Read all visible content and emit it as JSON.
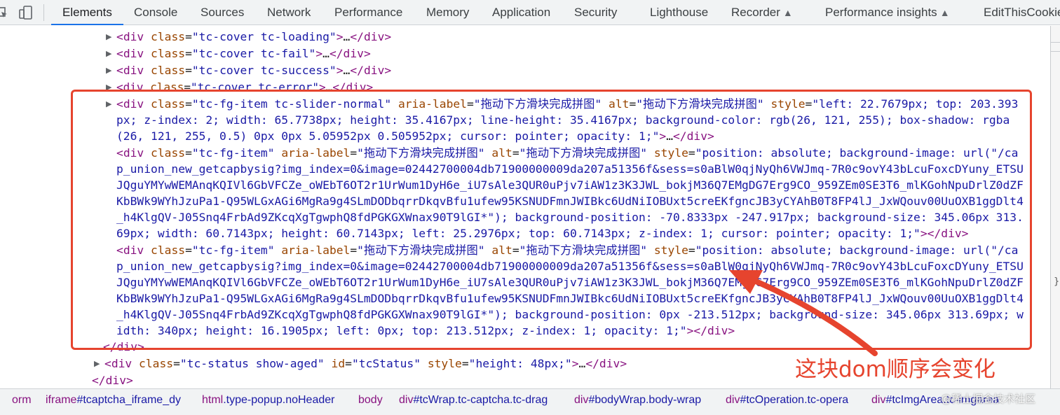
{
  "toolbar": {
    "tabs": [
      {
        "label": "Elements"
      },
      {
        "label": "Console"
      },
      {
        "label": "Sources"
      },
      {
        "label": "Network"
      },
      {
        "label": "Performance"
      },
      {
        "label": "Memory"
      },
      {
        "label": "Application"
      },
      {
        "label": "Security"
      },
      {
        "label": "Lighthouse"
      },
      {
        "label": "Recorder"
      },
      {
        "label": "Performance insights"
      },
      {
        "label": "EditThisCookie"
      }
    ],
    "active_tab": "Elements",
    "icons": [
      "inspect-element-icon",
      "device-toolbar-icon",
      "flask-icon"
    ]
  },
  "dom": {
    "open_tag": "<",
    "close": ">",
    "ellipsis": "…",
    "end_div": "</div>",
    "div": "div",
    "class_attr": "class",
    "eq": "=",
    "aria_label_attr": "aria-label",
    "alt_attr": "alt",
    "style_attr": "style",
    "id_attr": "id",
    "label_text": "\"拖动下方滑块完成拼图\"",
    "cover_loading": "\"tc-cover tc-loading\"",
    "cover_fail": "\"tc-cover tc-fail\"",
    "cover_success": "\"tc-cover tc-success\"",
    "cover_error": "\"tc-cover tc-error\"",
    "fg_item_slider": "\"tc-fg-item tc-slider-normal\"",
    "fg_item": "\"tc-fg-item\"",
    "slider_style_1": "\"left: 22.7679px; top: 203.393",
    "slider_style_2": "px; z-index: 2; width: 65.7738px; height: 35.4167px; line-height: 35.4167px; background-color: rgb(26, 121, 255); box-shadow: rgba",
    "slider_style_3": "(26, 121, 255, 0.5) 0px 0px 5.05952px 0.505952px; cursor: pointer; opacity: 1;\"",
    "item2_style_start": "\"position: absolute; background-image: url(\"/ca",
    "item2_url_1": "p_union_new_getcapbysig?img_index=0&image=02442700004db71900000009da207a51356f&sess=s0aBlW0qjNyQh6VWJmq-7R0c9ovY43bLcuFoxcDYuny_ETSU",
    "item2_url_2": "JQguYMYwWEMAnqKQIVl6GbVFCZe_oWEbT6OT2r1UrWum1DyH6e_iU7sAle3QUR0uPjv7iAW1z3K3JWL_bokjM36Q7EMgDG7Erg9CO_959ZEm0SE3T6_mlKGohNpuDrlZ0dZF",
    "item2_url_3": "KbBWk9WYhJzuPa1-Q95WLGxAGi6MgRa9g4SLmDODbqrrDkqvBfu1ufew95KSNUDFmnJWIBkc6UdNiIOBUxt5creEKfgncJB3yCYAhB0T8FP4lJ_JxWQouv00UuOXB1ggDlt4",
    "item2_url_4": "_h4KlgQV-J05Snq4FrbAd9ZKcqXgTgwphQ8fdPGKGXWnax90T9lGI*\"); background-position: -70.8333px -247.917px; background-size: 345.06px 313.",
    "item2_style_end": "69px; width: 60.7143px; height: 60.7143px; left: 25.2976px; top: 60.7143px; z-index: 1; cursor: pointer; opacity: 1;\"",
    "item3_url_4": "_h4KlgQV-J05Snq4FrbAd9ZKcqXgTgwphQ8fdPGKGXWnax90T9lGI*\"); background-position: 0px -213.512px; background-size: 345.06px 313.69px; w",
    "item3_style_end": "idth: 340px; height: 16.1905px; left: 0px; top: 213.512px; z-index: 1; opacity: 1;\"",
    "status_class": "\"tc-status show-aged\"",
    "status_id": "\"tcStatus\"",
    "status_style": "\"height: 48px;\""
  },
  "annotation": {
    "text": "这块dom顺序会变化",
    "color": "#e6442e"
  },
  "breadcrumb": [
    {
      "node": "orm",
      "cls": ""
    },
    {
      "node": "iframe",
      "cls": "#tcaptcha_iframe_dy"
    },
    {
      "node": "html",
      "cls": ".type-popup.noHeader"
    },
    {
      "node": "body",
      "cls": ""
    },
    {
      "node": "div",
      "cls": "#tcWrap.tc-captcha.tc-drag"
    },
    {
      "node": "div",
      "cls": "#bodyWrap.body-wrap"
    },
    {
      "node": "div",
      "cls": "#tcOperation.tc-opera"
    },
    {
      "node": "div",
      "cls": "#tcImgArea.tc-imgarea"
    }
  ],
  "watermark": "@稀土掘金技术社区",
  "colors": {
    "tag": "#881280",
    "attr_name": "#994500",
    "attr_value": "#1a1aa6",
    "accent": "#1a73e8",
    "annotation": "#e6442e"
  }
}
